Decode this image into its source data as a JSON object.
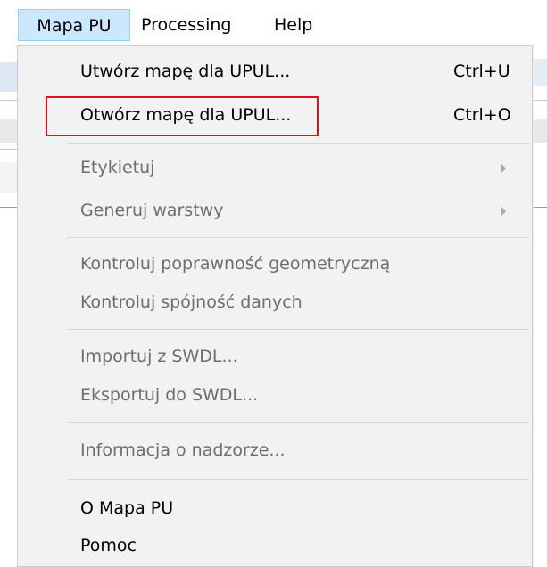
{
  "menubar": {
    "items": [
      {
        "label": "Mapa PU"
      },
      {
        "label": "Processing"
      },
      {
        "label": "Help"
      }
    ]
  },
  "menu": {
    "items": [
      {
        "label": "Utwórz mapę dla UPUL...",
        "shortcut": "Ctrl+U",
        "enabled": true
      },
      {
        "label": "Otwórz mapę dla UPUL...",
        "shortcut": "Ctrl+O",
        "enabled": true,
        "highlighted": true
      },
      {
        "label": "Etykietuj",
        "enabled": false,
        "submenu": true
      },
      {
        "label": "Generuj warstwy",
        "enabled": false,
        "submenu": true
      },
      {
        "label": "Kontroluj poprawność geometryczną",
        "enabled": false
      },
      {
        "label": "Kontroluj spójność danych",
        "enabled": false
      },
      {
        "label": "Importuj z SWDL...",
        "enabled": false
      },
      {
        "label": "Eksportuj do SWDL...",
        "enabled": false
      },
      {
        "label": "Informacja o nadzorze...",
        "enabled": false
      },
      {
        "label": "O Mapa PU",
        "enabled": true
      },
      {
        "label": "Pomoc",
        "enabled": true
      }
    ]
  },
  "colors": {
    "active_menubar_bg": "#cce8ff",
    "highlight_box": "#e0101a",
    "disabled_text": "#6d6d6d",
    "menu_bg": "#f2f2f2"
  },
  "icons": [
    "submenu-arrow-icon"
  ]
}
